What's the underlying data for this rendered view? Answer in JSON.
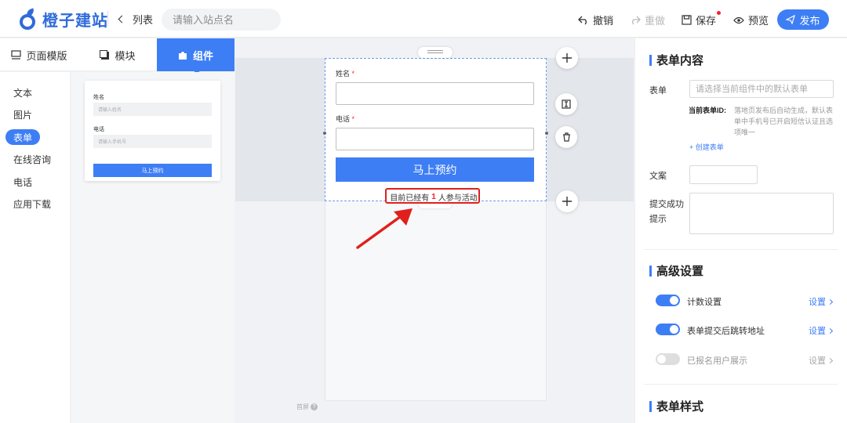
{
  "app": {
    "brand": "橙子建站"
  },
  "topbar": {
    "back_label": "列表",
    "site_search_placeholder": "请输入站点名",
    "undo": "撤销",
    "redo": "重做",
    "save": "保存",
    "preview": "预览",
    "publish": "发布"
  },
  "left_tabs": [
    {
      "label": "页面模版"
    },
    {
      "label": "模块"
    },
    {
      "label": "组件"
    }
  ],
  "categories": [
    {
      "label": "文本"
    },
    {
      "label": "图片"
    },
    {
      "label": "表单"
    },
    {
      "label": "在线咨询"
    },
    {
      "label": "电话"
    },
    {
      "label": "应用下载"
    }
  ],
  "component_preview": {
    "name_label": "姓名",
    "name_placeholder": "请输入姓名",
    "phone_label": "电话",
    "phone_placeholder": "请输入手机号",
    "button": "马上预约"
  },
  "canvas_form": {
    "name_label": "姓名",
    "phone_label": "电话",
    "required_mark": "*",
    "submit": "马上预约",
    "count_prefix": "目前已经有",
    "count_value": "1",
    "count_suffix": "人参与活动",
    "first_screen": "首屏",
    "help_icon": "?"
  },
  "right_panel": {
    "form_content_title": "表单内容",
    "form_label": "表单",
    "form_select_placeholder": "请选择当前组件中的默认表单",
    "current_form_id_key": "当前表单ID:",
    "current_form_id_hint": "落地页发布后自动生成，默认表单中手机号已开启短信认证且选项唯一",
    "create_form_link": "+ 创建表单",
    "copy_label": "文案",
    "success_label_1": "提交成功",
    "success_label_2": "提示",
    "advanced_title": "高级设置",
    "toggles": [
      {
        "label": "计数设置",
        "on": true,
        "action": "设置"
      },
      {
        "label": "表单提交后跳转地址",
        "on": true,
        "action": "设置"
      },
      {
        "label": "已报名用户展示",
        "on": false,
        "action": "设置"
      }
    ],
    "style_title": "表单样式"
  },
  "colors": {
    "accent": "#3d7ef5",
    "annotation": "#e0201c"
  }
}
